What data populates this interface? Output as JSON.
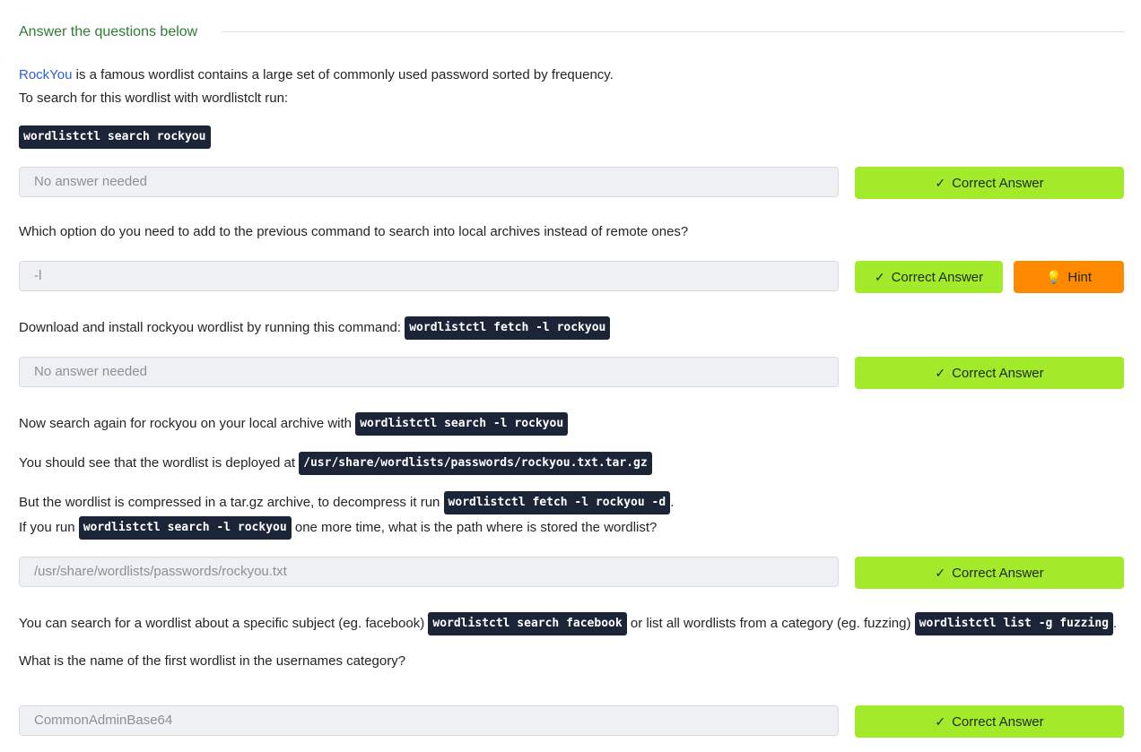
{
  "section": {
    "title": "Answer the questions below"
  },
  "q1": {
    "link": "RockYou",
    "line1_rest": " is a famous wordlist contains a large set of commonly used password sorted by frequency.",
    "line2": "To search for this wordlist with wordlistclt run:",
    "code": "wordlistctl search rockyou",
    "answer": "No answer needed",
    "button": "Correct Answer"
  },
  "q2": {
    "text": "Which option do you need to add to the previous command to search into local archives instead of remote ones?",
    "answer": "-l",
    "button": "Correct Answer",
    "hint": "Hint"
  },
  "q3": {
    "text": "Download and install rockyou wordlist by running this command: ",
    "code": "wordlistctl fetch -l rockyou",
    "answer": "No answer needed",
    "button": "Correct Answer"
  },
  "q4": {
    "line1_text": "Now search again for rockyou on your local archive with ",
    "line1_code": "wordlistctl search -l rockyou",
    "line2_text": "You should see that the wordlist is deployed at ",
    "line2_code": "/usr/share/wordlists/passwords/rockyou.txt.tar.gz",
    "line3_text": "But the wordlist is compressed in a tar.gz archive, to decompress it run ",
    "line3_code": "wordlistctl fetch -l rockyou -d",
    "line3_end": ".",
    "line4_text": "If you run ",
    "line4_code": "wordlistctl search -l rockyou",
    "line4_end": " one more time, what is the path where is stored the wordlist?",
    "answer": "/usr/share/wordlists/passwords/rockyou.txt",
    "button": "Correct Answer"
  },
  "q5": {
    "line1_a": "You can search for a wordlist about a specific subject (eg. facebook) ",
    "line1_code1": "wordlistctl search facebook",
    "line1_b": " or list all wordlists from a category (eg. fuzzing) ",
    "line1_code2": "wordlistctl list -g fuzzing",
    "line1_end": ".",
    "line2": "What is the name of the first wordlist in the usernames category?",
    "answer": "CommonAdminBase64",
    "button": "Correct Answer"
  },
  "icons": {
    "check": "check-icon",
    "hint": "lightbulb-icon"
  },
  "colors": {
    "accent_green": "#a3ea2a",
    "hint_orange": "#ff8a00",
    "code_bg": "#1c2538",
    "link": "#2c5fd8"
  }
}
